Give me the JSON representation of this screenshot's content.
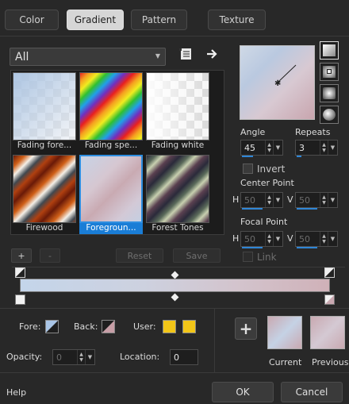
{
  "tabs": [
    {
      "label": "Color",
      "active": false
    },
    {
      "label": "Gradient",
      "active": true
    },
    {
      "label": "Pattern",
      "active": false
    },
    {
      "label": "Texture",
      "active": false
    }
  ],
  "category_dropdown": {
    "value": "All"
  },
  "gallery": {
    "items": [
      {
        "label": "Fading fore...",
        "selected": false
      },
      {
        "label": "Fading spe...",
        "selected": false
      },
      {
        "label": "Fading white",
        "selected": false
      },
      {
        "label": "Firewood",
        "selected": false
      },
      {
        "label": "Foregroun...",
        "selected": true
      },
      {
        "label": "Forest Tones",
        "selected": false
      }
    ]
  },
  "gallery_buttons": {
    "add": "+",
    "remove": "-",
    "reset": "Reset",
    "save": "Save"
  },
  "settings": {
    "angle_label": "Angle",
    "angle_value": "45",
    "repeats_label": "Repeats",
    "repeats_value": "3",
    "invert_label": "Invert",
    "center_point_label": "Center Point",
    "focal_point_label": "Focal Point",
    "h_label": "H",
    "v_label": "V",
    "center_h": "50",
    "center_v": "50",
    "focal_h": "50",
    "focal_v": "50",
    "link_label": "Link"
  },
  "bottom": {
    "fore_label": "Fore:",
    "back_label": "Back:",
    "user_label": "User:",
    "opacity_label": "Opacity:",
    "opacity_value": "0",
    "location_label": "Location:",
    "location_value": "0",
    "current_label": "Current",
    "previous_label": "Previous",
    "add_button": "+",
    "user_color": "#f2c618"
  },
  "footer": {
    "help": "Help",
    "ok": "OK",
    "cancel": "Cancel"
  },
  "icons": [
    "save-preset-icon",
    "load-preset-icon",
    "linear-style-icon",
    "rectangular-style-icon",
    "sunburst-style-icon",
    "radial-style-icon",
    "chevron-down-icon"
  ]
}
